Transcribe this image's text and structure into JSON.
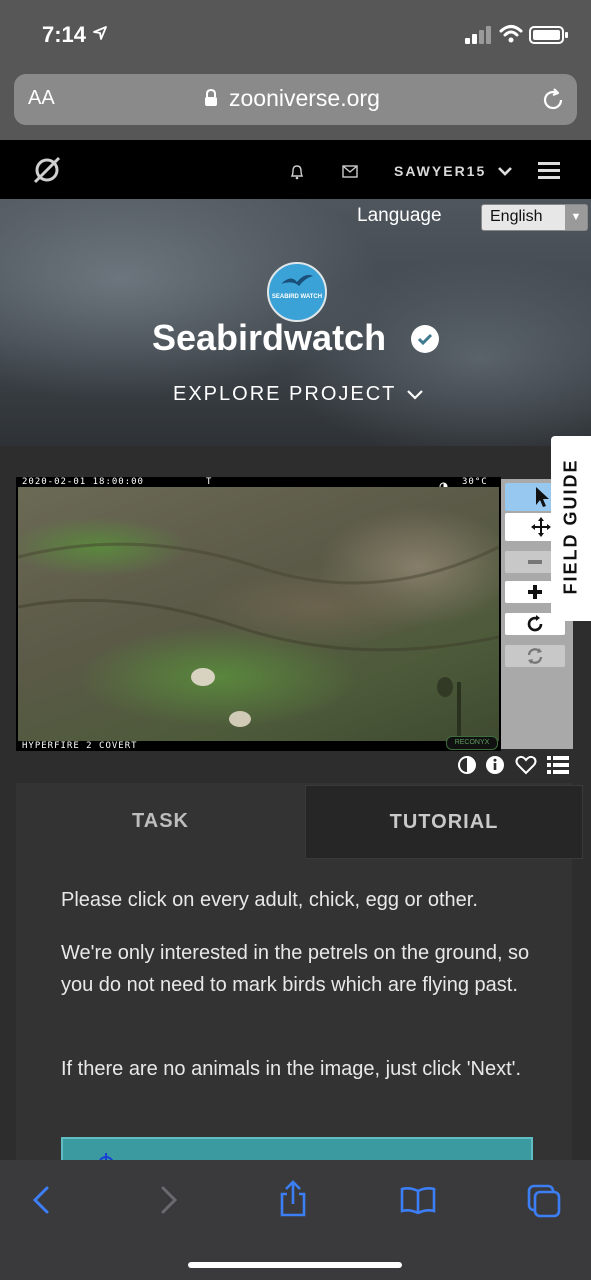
{
  "status": {
    "time": "7:14"
  },
  "browser": {
    "text_size_label": "AA",
    "url": "zooniverse.org"
  },
  "zooniverse_nav": {
    "username": "SAWYER15"
  },
  "hero": {
    "language_label": "Language",
    "language_selected": "English",
    "project_logo_text": "SEABIRD WATCH",
    "project_title": "Seabirdwatch",
    "explore_label": "EXPLORE PROJECT"
  },
  "subject": {
    "timestamp": "2020-02-01 18:00:00",
    "marker": "T",
    "temperature": "30°C",
    "camera_model": "HYPERFIRE 2 COVERT",
    "brand": "RECONYX"
  },
  "field_guide": {
    "label": "FIELD GUIDE"
  },
  "tabs": {
    "task": "TASK",
    "tutorial": "TUTORIAL"
  },
  "instructions": [
    "Please click on every adult, chick, egg or other.",
    "We're only interested in the petrels on the ground, so you do not need to mark birds which are flying past.",
    "If there are no animals in the image, just click 'Next'."
  ],
  "colors": {
    "accent_blue": "#3b7ef5",
    "teal_answer": "#3a9aa0",
    "verified_badge": "#3f7a91"
  }
}
